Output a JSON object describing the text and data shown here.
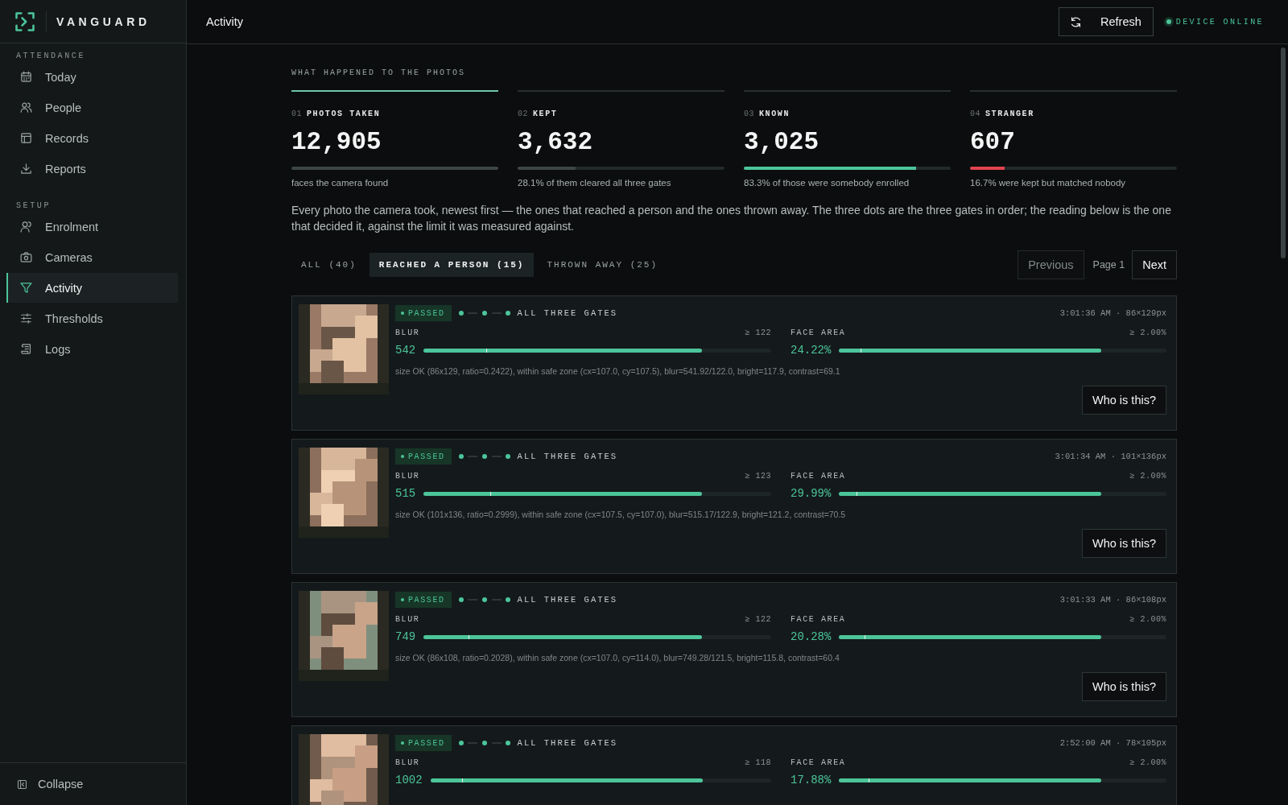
{
  "brand": "VANGUARD",
  "sidebar": {
    "sections": [
      {
        "title": "ATTENDANCE",
        "items": [
          {
            "label": "Today",
            "selected": false
          },
          {
            "label": "People",
            "selected": false
          },
          {
            "label": "Records",
            "selected": false
          },
          {
            "label": "Reports",
            "selected": false
          }
        ]
      },
      {
        "title": "SETUP",
        "items": [
          {
            "label": "Enrolment",
            "selected": false
          },
          {
            "label": "Cameras",
            "selected": false
          },
          {
            "label": "Activity",
            "selected": true
          },
          {
            "label": "Thresholds",
            "selected": false
          },
          {
            "label": "Logs",
            "selected": false
          }
        ]
      }
    ],
    "collapse": "Collapse"
  },
  "header": {
    "title": "Activity",
    "refresh": "Refresh",
    "device_status": {
      "label": "DEVICE ONLINE",
      "online": true
    }
  },
  "section_title": "WHAT HAPPENED TO THE PHOTOS",
  "metrics": [
    {
      "number": "01",
      "label": "PHOTOS TAKEN",
      "value": "12,905",
      "caption": "faces the camera found",
      "level": 1.0,
      "color": "#3d4646",
      "selected": true
    },
    {
      "number": "02",
      "label": "KEPT",
      "value": "3,632",
      "caption": "28.1% of them cleared all three gates",
      "level": 0.281,
      "color": "#3d4646",
      "selected": false
    },
    {
      "number": "03",
      "label": "KNOWN",
      "value": "3,025",
      "caption": "83.3% of those were somebody enrolled",
      "level": 0.833,
      "color": "#4cc59a",
      "selected": false
    },
    {
      "number": "04",
      "label": "STRANGER",
      "value": "607",
      "caption": "16.7% were kept but matched nobody",
      "level": 0.167,
      "color": "#e0444e",
      "selected": false
    }
  ],
  "description": "Every photo the camera took, newest first — the ones that reached a person and the ones thrown away. The three dots are the three gates in order; the reading below is the one that decided it, against the limit it was measured against.",
  "filters": [
    {
      "label": "ALL (40)",
      "selected": false
    },
    {
      "label": "REACHED A PERSON (15)",
      "selected": true
    },
    {
      "label": "THROWN AWAY (25)",
      "selected": false
    }
  ],
  "pagination": {
    "previous": {
      "label": "Previous",
      "disabled": true
    },
    "page": "Page 1",
    "next": {
      "label": "Next",
      "disabled": false
    }
  },
  "events": [
    {
      "kind": "passed",
      "status_label": "PASSED",
      "gates": "ALL THREE GATES",
      "meta": "3:01:36 AM · 86×129px",
      "readings": [
        {
          "name": "BLUR",
          "limit": "≥ 122",
          "value": "542",
          "level": 0.8
        },
        {
          "name": "FACE AREA",
          "limit": "≥ 2.00%",
          "value": "24.22%",
          "level": 0.8
        }
      ],
      "details": "size OK (86x129, ratio=0.2422), within safe zone (cx=107.0, cy=107.5), blur=541.92/122.0, bright=117.9, contrast=69.1",
      "action": "Who is this?"
    },
    {
      "kind": "passed",
      "status_label": "PASSED",
      "gates": "ALL THREE GATES",
      "meta": "3:01:34 AM · 101×136px",
      "readings": [
        {
          "name": "BLUR",
          "limit": "≥ 123",
          "value": "515",
          "level": 0.8
        },
        {
          "name": "FACE AREA",
          "limit": "≥ 2.00%",
          "value": "29.99%",
          "level": 0.8
        }
      ],
      "details": "size OK (101x136, ratio=0.2999), within safe zone (cx=107.5, cy=107.0), blur=515.17/122.9, bright=121.2, contrast=70.5",
      "action": "Who is this?"
    },
    {
      "kind": "passed",
      "status_label": "PASSED",
      "gates": "ALL THREE GATES",
      "meta": "3:01:33 AM · 86×108px",
      "readings": [
        {
          "name": "BLUR",
          "limit": "≥ 122",
          "value": "749",
          "level": 0.8
        },
        {
          "name": "FACE AREA",
          "limit": "≥ 2.00%",
          "value": "20.28%",
          "level": 0.8
        }
      ],
      "details": "size OK (86x108, ratio=0.2028), within safe zone (cx=107.0, cy=114.0), blur=749.28/121.5, bright=115.8, contrast=60.4",
      "action": "Who is this?"
    },
    {
      "kind": "passed",
      "status_label": "PASSED",
      "gates": "ALL THREE GATES",
      "meta": "2:52:00 AM · 78×105px",
      "readings": [
        {
          "name": "BLUR",
          "limit": "≥ 118",
          "value": "1002",
          "level": 0.8
        },
        {
          "name": "FACE AREA",
          "limit": "≥ 2.00%",
          "value": "17.88%",
          "level": 0.8
        }
      ]
    }
  ]
}
